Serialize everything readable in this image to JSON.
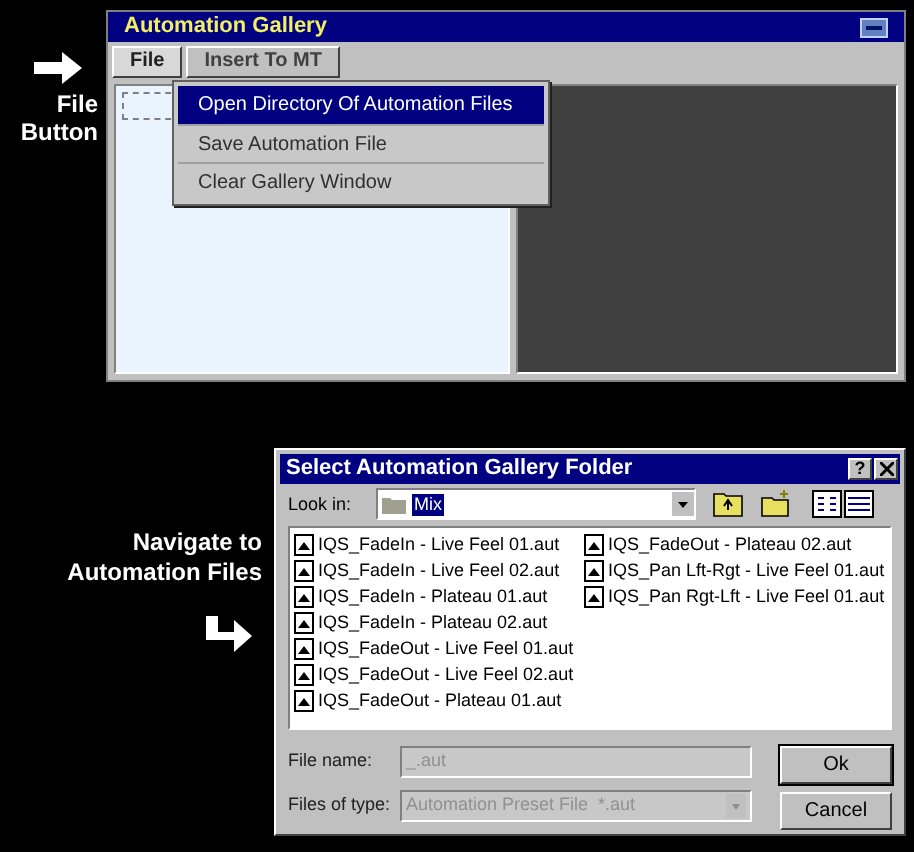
{
  "annotations": [
    {
      "lines": [
        "File",
        "Button"
      ]
    },
    {
      "lines": [
        "Navigate to",
        "Automation Files"
      ]
    }
  ],
  "gallery_window": {
    "title": "Automation Gallery",
    "menu": [
      {
        "label": "File",
        "selected": true
      },
      {
        "label": "Insert To MT",
        "selected": false
      }
    ],
    "file_menu": [
      {
        "label": "Open Directory Of Automation Files",
        "selected": true
      },
      {
        "label": "Save Automation File",
        "selected": false
      },
      {
        "label": "Clear Gallery Window",
        "selected": false
      }
    ]
  },
  "dialog": {
    "title": "Select Automation Gallery Folder",
    "help_button": "?",
    "look_in_label": "Look in:",
    "look_in_value": "Mix",
    "files": [
      "IQS_FadeIn - Live Feel 01.aut",
      "IQS_FadeIn - Live Feel 02.aut",
      "IQS_FadeIn - Plateau 01.aut",
      "IQS_FadeIn - Plateau 02.aut",
      "IQS_FadeOut - Live Feel 01.aut",
      "IQS_FadeOut - Live Feel 02.aut",
      "IQS_FadeOut - Plateau 01.aut",
      "IQS_FadeOut - Plateau 02.aut",
      "IQS_Pan Lft-Rgt - Live Feel 01.aut",
      "IQS_Pan Rgt-Lft - Live Feel 01.aut"
    ],
    "file_name_label": "File name:",
    "file_name_value": "_.aut",
    "file_type_label": "Files of type:",
    "file_type_value": "Automation Preset File  *.aut",
    "buttons": [
      "Ok",
      "Cancel"
    ]
  }
}
